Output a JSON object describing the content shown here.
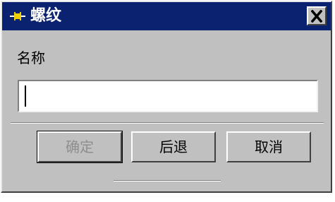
{
  "dialog": {
    "title": "螺纹",
    "title_icon": "thread-tool-icon",
    "close_icon": "close-icon",
    "colors": {
      "titlebar": "#0b2270",
      "face": "#c0c0c0",
      "title_text": "#ffffff",
      "disabled_text": "#8e8e8e"
    }
  },
  "form": {
    "name_label": "名称",
    "name_value": ""
  },
  "buttons": {
    "ok_label": "确定",
    "ok_disabled": true,
    "back_label": "后退",
    "cancel_label": "取消"
  }
}
